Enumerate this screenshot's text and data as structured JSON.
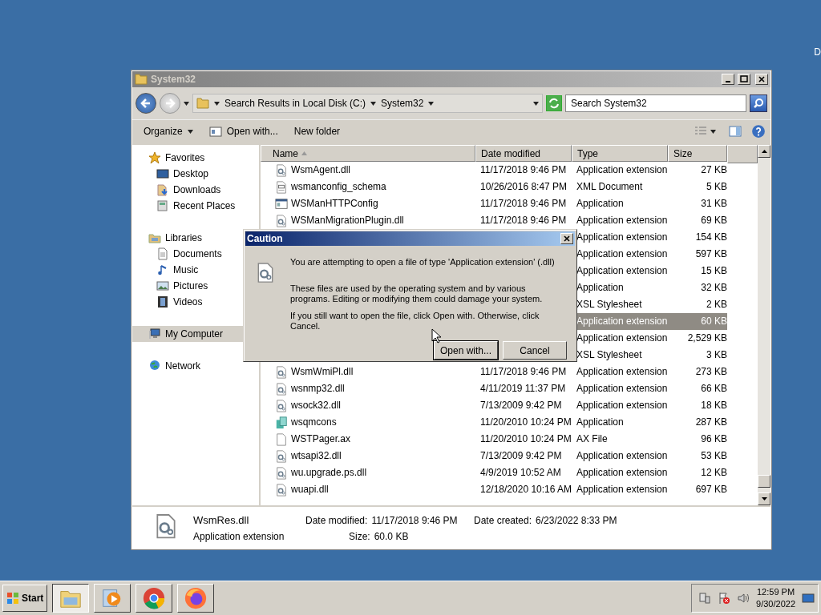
{
  "desktop": {
    "icon_label": "D"
  },
  "window": {
    "title": "System32",
    "active": false
  },
  "address": {
    "crumbs": [
      "Search Results in Local Disk (C:)",
      "System32"
    ],
    "search_placeholder": "Search System32"
  },
  "toolbar": {
    "buttons": [
      {
        "label": "Organize",
        "menu": true
      },
      {
        "label": "Open with...",
        "menu": false
      },
      {
        "label": "New folder",
        "menu": false
      }
    ]
  },
  "nav": [
    {
      "label": "Favorites",
      "kind": "star",
      "selected": false,
      "children": [
        {
          "label": "Desktop",
          "kind": "desktop",
          "selected": false
        },
        {
          "label": "Downloads",
          "kind": "downloads",
          "selected": false
        },
        {
          "label": "Recent Places",
          "kind": "recent",
          "selected": false
        }
      ]
    },
    {
      "label": "Libraries",
      "kind": "library",
      "selected": false,
      "children": [
        {
          "label": "Documents",
          "kind": "document",
          "selected": false
        },
        {
          "label": "Music",
          "kind": "music",
          "selected": false
        },
        {
          "label": "Pictures",
          "kind": "pictures",
          "selected": false
        },
        {
          "label": "Videos",
          "kind": "videos",
          "selected": false
        }
      ]
    },
    {
      "label": "My Computer",
      "kind": "computer",
      "selected": true
    },
    {
      "label": "Network",
      "kind": "network",
      "selected": false
    }
  ],
  "columns": [
    {
      "label": "Name",
      "sorted": true
    },
    {
      "label": "Date modified",
      "sorted": false
    },
    {
      "label": "Type",
      "sorted": false
    },
    {
      "label": "Size",
      "sorted": false
    }
  ],
  "files": [
    {
      "kind": "extension",
      "name": "WsmAgent.dll",
      "date": "11/17/2018 9:46 PM",
      "type": "Application extension",
      "size": "27 KB",
      "selected": false
    },
    {
      "kind": "markup",
      "name": "wsmanconfig_schema",
      "date": "10/26/2016 8:47 PM",
      "type": "XML Document",
      "size": "5 KB",
      "selected": false
    },
    {
      "kind": "program",
      "name": "WSManHTTPConfig",
      "date": "11/17/2018 9:46 PM",
      "type": "Application",
      "size": "31 KB",
      "selected": false
    },
    {
      "kind": "extension",
      "name": "WSManMigrationPlugin.dll",
      "date": "11/17/2018 9:46 PM",
      "type": "Application extension",
      "size": "69 KB",
      "selected": false
    },
    {
      "type": "Application extension",
      "size": "154 KB",
      "selected": false
    },
    {
      "type": "Application extension",
      "size": "597 KB",
      "selected": false
    },
    {
      "type": "Application extension",
      "size": "15 KB",
      "selected": false
    },
    {
      "type": "Application",
      "size": "32 KB",
      "selected": false
    },
    {
      "type": "XSL Stylesheet",
      "size": "2 KB",
      "selected": false
    },
    {
      "type": "Application extension",
      "size": "60 KB",
      "selected": true
    },
    {
      "type": "Application extension",
      "size": "2,529 KB",
      "selected": false
    },
    {
      "type": "XSL Stylesheet",
      "size": "3 KB",
      "selected": false
    },
    {
      "kind": "extension",
      "name": "WsmWmiPl.dll",
      "date": "11/17/2018 9:46 PM",
      "type": "Application extension",
      "size": "273 KB",
      "selected": false
    },
    {
      "kind": "extension",
      "name": "wsnmp32.dll",
      "date": "4/11/2019 11:37 PM",
      "type": "Application extension",
      "size": "66 KB",
      "selected": false
    },
    {
      "kind": "extension",
      "name": "wsock32.dll",
      "date": "7/13/2009 9:42 PM",
      "type": "Application extension",
      "size": "18 KB",
      "selected": false
    },
    {
      "kind": "setup",
      "name": "wsqmcons",
      "date": "11/20/2010 10:24 PM",
      "type": "Application",
      "size": "287 KB",
      "selected": false
    },
    {
      "kind": "blank",
      "name": "WSTPager.ax",
      "date": "11/20/2010 10:24 PM",
      "type": "AX File",
      "size": "96 KB",
      "selected": false
    },
    {
      "kind": "extension",
      "name": "wtsapi32.dll",
      "date": "7/13/2009 9:42 PM",
      "type": "Application extension",
      "size": "53 KB",
      "selected": false
    },
    {
      "kind": "extension",
      "name": "wu.upgrade.ps.dll",
      "date": "4/9/2019 10:52 AM",
      "type": "Application extension",
      "size": "12 KB",
      "selected": false
    },
    {
      "kind": "extension",
      "name": "wuapi.dll",
      "date": "12/18/2020 10:16 AM",
      "type": "Application extension",
      "size": "697 KB",
      "selected": false
    }
  ],
  "details": {
    "name": "WsmRes.dll",
    "type": "Application extension",
    "modified_label": "Date modified:",
    "modified": "11/17/2018 9:46 PM",
    "created_label": "Date created:",
    "created": "6/23/2022 8:33 PM",
    "size_label": "Size:",
    "size": "60.0 KB"
  },
  "dialog": {
    "title": "Caution",
    "message": "You are attempting to open a file of type 'Application extension' (.dll)",
    "paragraphs": [
      "These files are used by the operating system and by various programs. Editing or modifying them could damage your system.",
      "If you still want to open the file, click Open with. Otherwise, click Cancel."
    ],
    "buttons": [
      {
        "label": "Open with...",
        "default": true
      },
      {
        "label": "Cancel",
        "default": false
      }
    ]
  },
  "taskbar": {
    "start": "Start",
    "apps": [
      {
        "kind": "explorer",
        "selected": true
      },
      {
        "kind": "media",
        "selected": false
      },
      {
        "kind": "chrome",
        "selected": false
      },
      {
        "kind": "firefox",
        "selected": false
      }
    ],
    "time": "12:59 PM",
    "date": "9/30/2022"
  }
}
